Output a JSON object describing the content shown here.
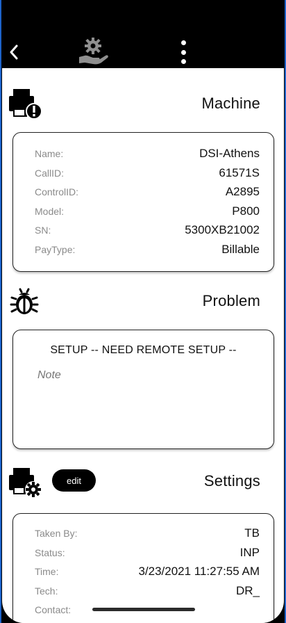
{
  "header": {
    "back_icon": "chevron-left-icon",
    "logo_icon": "gear-hand-icon",
    "menu_icon": "more-vertical-icon"
  },
  "machine": {
    "title": "Machine",
    "icon": "printer-alert-icon",
    "fields": [
      {
        "label": "Name:",
        "value": "DSI-Athens"
      },
      {
        "label": "CallID:",
        "value": "61571S"
      },
      {
        "label": "ControlID:",
        "value": "A2895"
      },
      {
        "label": "Model:",
        "value": "P800"
      },
      {
        "label": "SN:",
        "value": "5300XB21002"
      },
      {
        "label": "PayType:",
        "value": "Billable"
      }
    ]
  },
  "problem": {
    "title": "Problem",
    "icon": "bug-icon",
    "description": "SETUP -- NEED REMOTE SETUP --",
    "note_placeholder": "Note"
  },
  "settings": {
    "title": "Settings",
    "icon": "printer-gear-icon",
    "edit_label": "edit",
    "fields": [
      {
        "label": "Taken By:",
        "value": "TB"
      },
      {
        "label": "Status:",
        "value": "INP"
      },
      {
        "label": "Time:",
        "value": "3/23/2021 11:27:55 AM"
      },
      {
        "label": "Tech:",
        "value": "DR_"
      },
      {
        "label": "Contact:",
        "value": ""
      }
    ]
  },
  "colors": {
    "header_bg": "#000000",
    "accent_edge": "#1d63c9",
    "label_gray": "#8a8a8a"
  }
}
